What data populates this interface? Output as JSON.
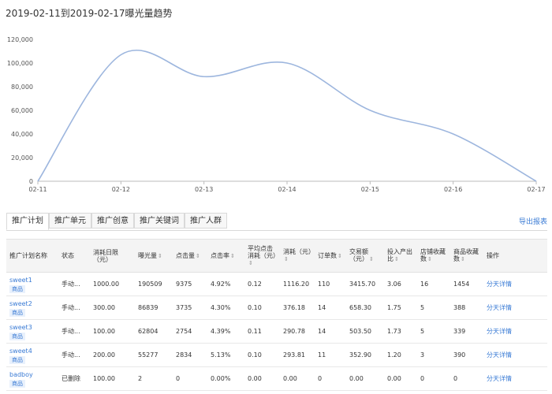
{
  "header": {
    "title": "2019-02-11到2019-02-17曝光量趋势"
  },
  "chart_data": {
    "type": "line",
    "title": "2019-02-11到2019-02-17曝光量趋势",
    "x": [
      "02-11",
      "02-12",
      "02-13",
      "02-14",
      "02-15",
      "02-16",
      "02-17"
    ],
    "y_ticks": [
      "0",
      "20,000",
      "40,000",
      "60,000",
      "80,000",
      "100,000",
      "120,000"
    ],
    "ylim": [
      0,
      120000
    ],
    "series": [
      {
        "values": [
          0,
          107000,
          88500,
          100000,
          60000,
          40000,
          0
        ]
      }
    ],
    "line_color": "#9db6de",
    "grid": false
  },
  "tabs": [
    {
      "label": "推广计划",
      "active": true
    },
    {
      "label": "推广单元"
    },
    {
      "label": "推广创意"
    },
    {
      "label": "推广关键词"
    },
    {
      "label": "推广人群"
    }
  ],
  "export_label": "导出报表",
  "table": {
    "headers": [
      "推广计划名称",
      "状态",
      "消耗日限（元）",
      "曝光量",
      "点击量",
      "点击率",
      "平均点击消耗（元）",
      "消耗（元）",
      "订单数",
      "交易额（元）",
      "投入产出比",
      "店铺收藏数",
      "商品收藏数",
      "操作"
    ],
    "rows": [
      {
        "name": "sweet1",
        "tag": "商品",
        "status": "手动...",
        "budget": "1000.00",
        "impressions": "190509",
        "clicks": "9375",
        "ctr": "4.92%",
        "cpc": "0.12",
        "cost": "1116.20",
        "orders": "110",
        "revenue": "3415.70",
        "roi": "3.06",
        "shop_fav": "16",
        "item_fav": "1454",
        "action": "分天详情"
      },
      {
        "name": "sweet2",
        "tag": "商品",
        "status": "手动...",
        "budget": "300.00",
        "impressions": "86839",
        "clicks": "3735",
        "ctr": "4.30%",
        "cpc": "0.10",
        "cost": "376.18",
        "orders": "14",
        "revenue": "658.30",
        "roi": "1.75",
        "shop_fav": "5",
        "item_fav": "388",
        "action": "分天详情"
      },
      {
        "name": "sweet3",
        "tag": "商品",
        "status": "手动...",
        "budget": "100.00",
        "impressions": "62804",
        "clicks": "2754",
        "ctr": "4.39%",
        "cpc": "0.11",
        "cost": "290.78",
        "orders": "14",
        "revenue": "503.50",
        "roi": "1.73",
        "shop_fav": "5",
        "item_fav": "339",
        "action": "分天详情"
      },
      {
        "name": "sweet4",
        "tag": "商品",
        "status": "手动...",
        "budget": "200.00",
        "impressions": "55277",
        "clicks": "2834",
        "ctr": "5.13%",
        "cpc": "0.10",
        "cost": "293.81",
        "orders": "11",
        "revenue": "352.90",
        "roi": "1.20",
        "shop_fav": "3",
        "item_fav": "390",
        "action": "分天详情"
      },
      {
        "name": "badboy",
        "tag": "商品",
        "status": "已删除",
        "budget": "100.00",
        "impressions": "2",
        "clicks": "0",
        "ctr": "0.00%",
        "cpc": "0.00",
        "cost": "0.00",
        "orders": "0",
        "revenue": "0.00",
        "roi": "0.00",
        "shop_fav": "0",
        "item_fav": "0",
        "action": "分天详情"
      }
    ]
  }
}
